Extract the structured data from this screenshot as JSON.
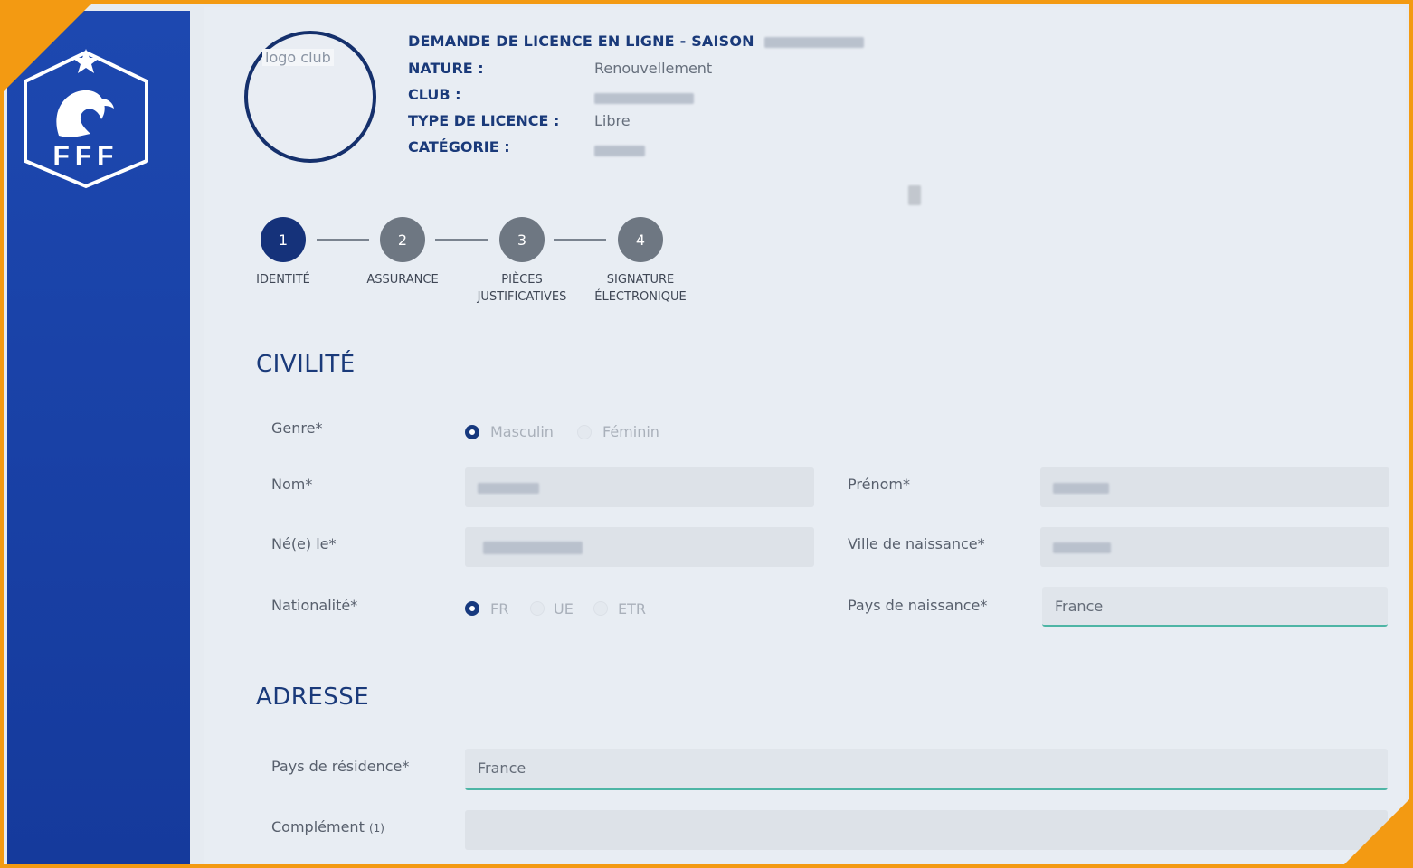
{
  "header": {
    "title": "DEMANDE DE LICENCE EN LIGNE - SAISON",
    "club_logo_placeholder": "logo club",
    "rows": [
      {
        "label": "NATURE :",
        "value": "Renouvellement"
      },
      {
        "label": "CLUB :",
        "value": ""
      },
      {
        "label": "TYPE DE LICENCE :",
        "value": "Libre"
      },
      {
        "label": "CATÉGORIE :",
        "value": ""
      }
    ]
  },
  "stepper": {
    "steps": [
      {
        "number": "1",
        "label": "IDENTITÉ"
      },
      {
        "number": "2",
        "label": "ASSURANCE"
      },
      {
        "number": "3",
        "label": "PIÈCES\nJUSTIFICATIVES"
      },
      {
        "number": "4",
        "label": "SIGNATURE\nÉLECTRONIQUE"
      }
    ]
  },
  "civilite": {
    "section_title": "CIVILITÉ",
    "genre_label": "Genre*",
    "genre_options": [
      "Masculin",
      "Féminin"
    ],
    "nom_label": "Nom*",
    "prenom_label": "Prénom*",
    "naissance_label": "Né(e) le*",
    "ville_label": "Ville de naissance*",
    "nationalite_label": "Nationalité*",
    "nationalite_options": [
      "FR",
      "UE",
      "ETR"
    ],
    "pays_label": "Pays de naissance*",
    "pays_value": "France"
  },
  "adresse": {
    "section_title": "ADRESSE",
    "pays_residence_label": "Pays de résidence*",
    "pays_residence_value": "France",
    "complement_label": "Complément",
    "complement_note": "(1)"
  },
  "colors": {
    "sidebar": "#1d48b0",
    "accent_navy": "#1a3a7a",
    "step_active": "#15327a",
    "step_inactive": "#6e7782",
    "frame_orange": "#f39a12",
    "input_underline": "#4eb5a5"
  }
}
